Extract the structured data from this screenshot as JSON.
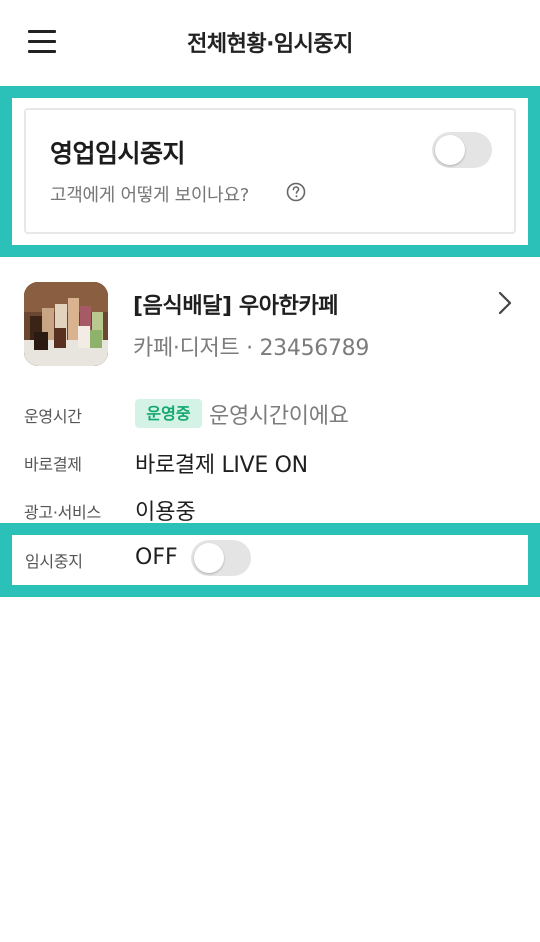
{
  "header": {
    "menu_icon": "hamburger-menu-icon",
    "title": "전체현황·임시중지"
  },
  "pause_card": {
    "title": "영업임시중지",
    "subtitle": "고객에게 어떻게 보이나요?",
    "help_icon": "question-circle-icon",
    "toggle_on": false
  },
  "store": {
    "name": "[음식배달] 우아한카페",
    "meta": "카페·디저트 · 23456789",
    "chevron_icon": "chevron-right-icon"
  },
  "rows": {
    "hours": {
      "label": "운영시간",
      "badge": "운영중",
      "value": "운영시간이에요"
    },
    "payment": {
      "label": "바로결제",
      "value": "바로결제 LIVE ON"
    },
    "ads": {
      "label": "광고·서비스",
      "value": "이용중"
    },
    "pause": {
      "label": "임시중지",
      "value": "OFF",
      "toggle_on": false
    }
  },
  "colors": {
    "highlight": "#2cc1b8",
    "badge_bg": "#d4f3e6",
    "badge_text": "#14a870",
    "toggle_off": "#e4e4e4"
  }
}
